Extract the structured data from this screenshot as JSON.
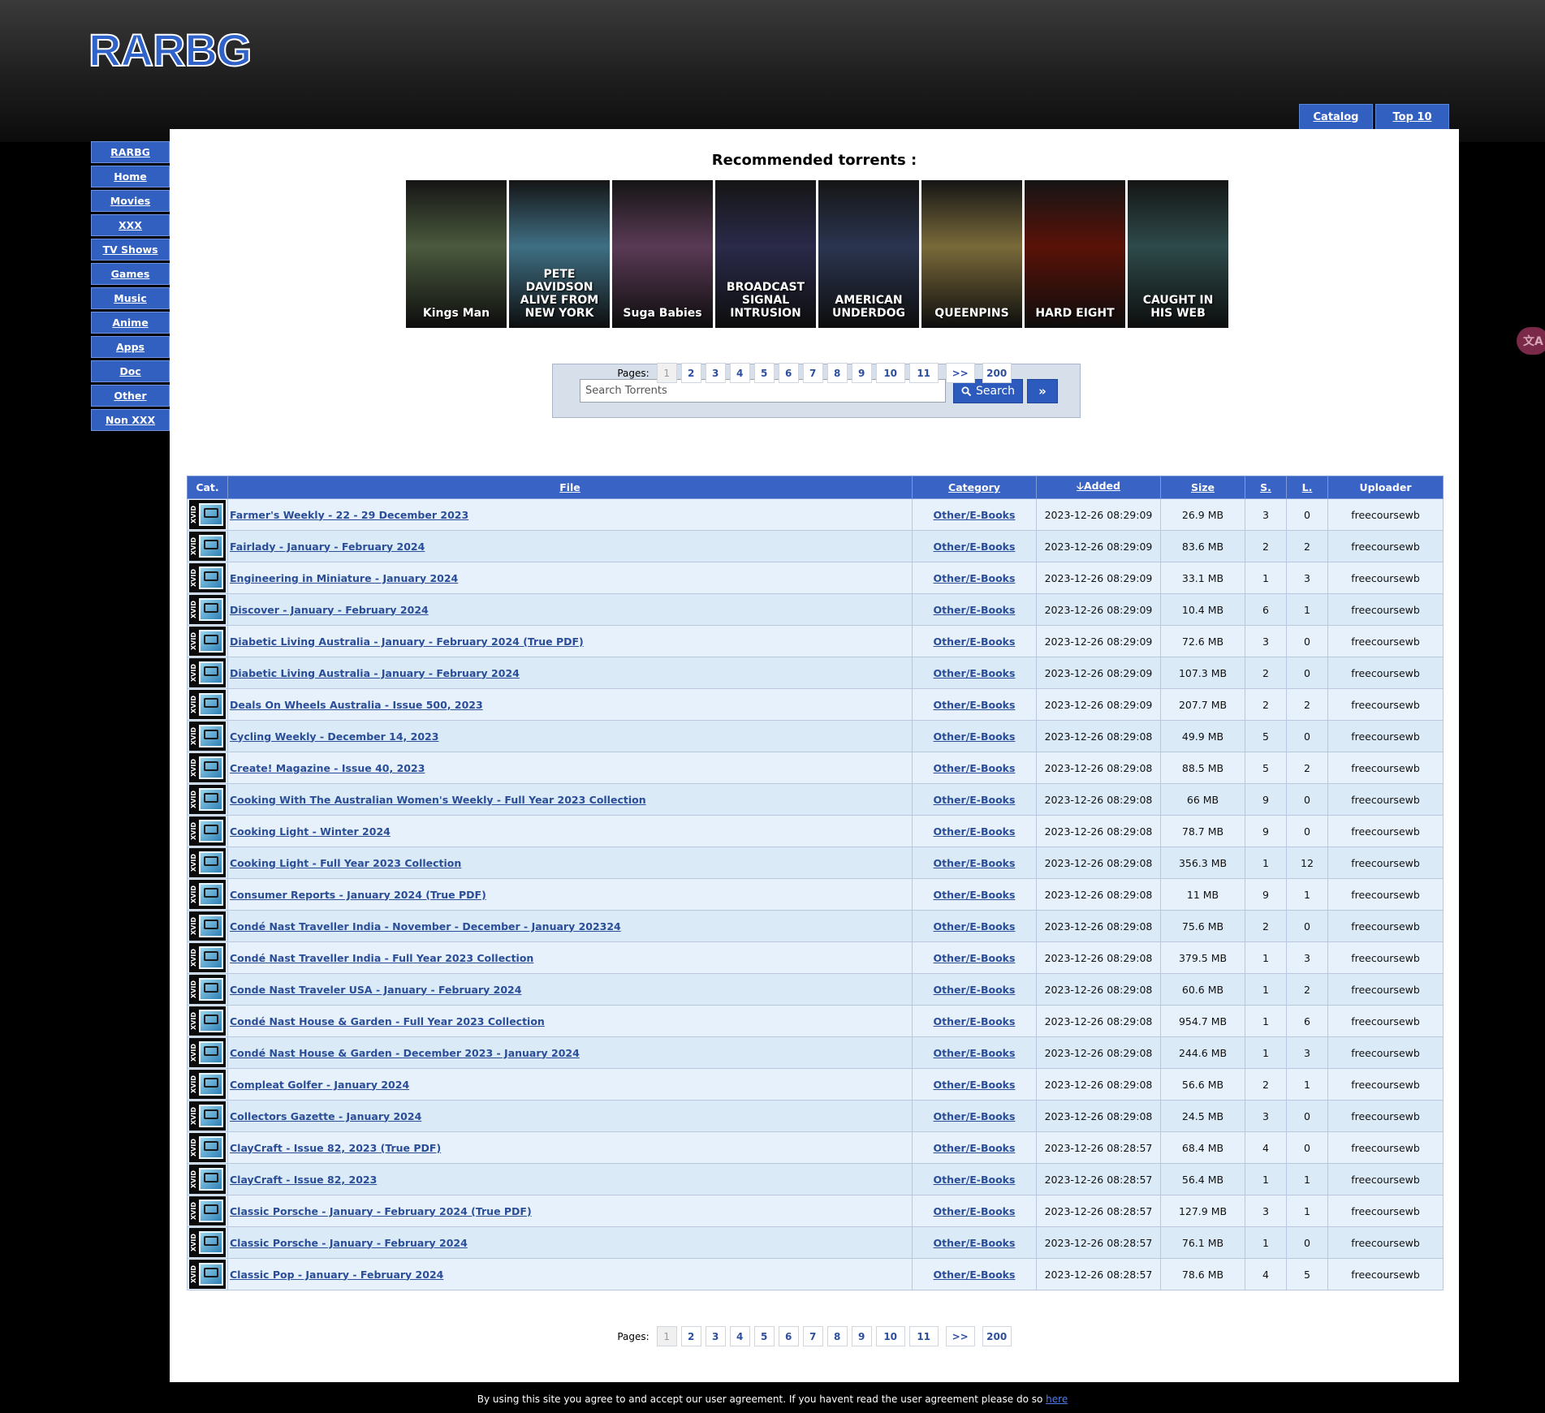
{
  "logo": "RARBG",
  "top_tabs": [
    "Catalog",
    "Top 10"
  ],
  "sidebar": [
    "RARBG",
    "Home",
    "Movies",
    "XXX",
    "TV Shows",
    "Games",
    "Music",
    "Anime",
    "Apps",
    "Doc",
    "Other",
    "Non XXX"
  ],
  "recommended": {
    "title": "Recommended torrents :",
    "posters": [
      {
        "text": "Kings Man",
        "bg": "#4b5a3e"
      },
      {
        "text": "PETE DAVIDSON ALIVE FROM NEW YORK",
        "bg": "#3f6f84"
      },
      {
        "text": "Suga Babies",
        "bg": "#5a3a55"
      },
      {
        "text": "BROADCAST SIGNAL INTRUSION",
        "bg": "#2a2a4a"
      },
      {
        "text": "AMERICAN UNDERDOG",
        "bg": "#2b3550"
      },
      {
        "text": "QUEENPINS",
        "bg": "#7a6a3a"
      },
      {
        "text": "HARD EIGHT",
        "bg": "#5a1208"
      },
      {
        "text": "CAUGHT IN HIS WEB",
        "bg": "#2e4a4a"
      }
    ]
  },
  "search": {
    "placeholder": "Search Torrents",
    "button": "Search",
    "advanced": "»"
  },
  "pager": {
    "label": "Pages:",
    "pages": [
      "1",
      "2",
      "3",
      "4",
      "5",
      "6",
      "7",
      "8",
      "9",
      "10",
      "11"
    ],
    "next": ">>",
    "last": "200"
  },
  "table": {
    "headers": [
      "Cat.",
      "File",
      "Category",
      "Added",
      "Size",
      "S.",
      "L.",
      "Uploader"
    ],
    "cat_icon_label": "XVID",
    "rows": [
      {
        "file": "Farmer's Weekly - 22 - 29 December 2023",
        "category": "Other/E-Books",
        "added": "2023-12-26 08:29:09",
        "size": "26.9 MB",
        "s": "3",
        "l": "0",
        "uploader": "freecoursewb"
      },
      {
        "file": "Fairlady - January - February 2024",
        "category": "Other/E-Books",
        "added": "2023-12-26 08:29:09",
        "size": "83.6 MB",
        "s": "2",
        "l": "2",
        "uploader": "freecoursewb"
      },
      {
        "file": "Engineering in Miniature - January 2024",
        "category": "Other/E-Books",
        "added": "2023-12-26 08:29:09",
        "size": "33.1 MB",
        "s": "1",
        "l": "3",
        "uploader": "freecoursewb"
      },
      {
        "file": "Discover - January - February 2024",
        "category": "Other/E-Books",
        "added": "2023-12-26 08:29:09",
        "size": "10.4 MB",
        "s": "6",
        "l": "1",
        "uploader": "freecoursewb"
      },
      {
        "file": "Diabetic Living Australia - January - February 2024 (True PDF)",
        "category": "Other/E-Books",
        "added": "2023-12-26 08:29:09",
        "size": "72.6 MB",
        "s": "3",
        "l": "0",
        "uploader": "freecoursewb"
      },
      {
        "file": "Diabetic Living Australia - January - February 2024",
        "category": "Other/E-Books",
        "added": "2023-12-26 08:29:09",
        "size": "107.3 MB",
        "s": "2",
        "l": "0",
        "uploader": "freecoursewb"
      },
      {
        "file": "Deals On Wheels Australia - Issue 500, 2023",
        "category": "Other/E-Books",
        "added": "2023-12-26 08:29:09",
        "size": "207.7 MB",
        "s": "2",
        "l": "2",
        "uploader": "freecoursewb"
      },
      {
        "file": "Cycling Weekly - December 14, 2023",
        "category": "Other/E-Books",
        "added": "2023-12-26 08:29:08",
        "size": "49.9 MB",
        "s": "5",
        "l": "0",
        "uploader": "freecoursewb"
      },
      {
        "file": "Create! Magazine - Issue 40, 2023",
        "category": "Other/E-Books",
        "added": "2023-12-26 08:29:08",
        "size": "88.5 MB",
        "s": "5",
        "l": "2",
        "uploader": "freecoursewb"
      },
      {
        "file": "Cooking With The Australian Women's Weekly - Full Year 2023 Collection",
        "category": "Other/E-Books",
        "added": "2023-12-26 08:29:08",
        "size": "66 MB",
        "s": "9",
        "l": "0",
        "uploader": "freecoursewb"
      },
      {
        "file": "Cooking Light - Winter 2024",
        "category": "Other/E-Books",
        "added": "2023-12-26 08:29:08",
        "size": "78.7 MB",
        "s": "9",
        "l": "0",
        "uploader": "freecoursewb"
      },
      {
        "file": "Cooking Light - Full Year 2023 Collection",
        "category": "Other/E-Books",
        "added": "2023-12-26 08:29:08",
        "size": "356.3 MB",
        "s": "1",
        "l": "12",
        "uploader": "freecoursewb"
      },
      {
        "file": "Consumer Reports - January 2024 (True PDF)",
        "category": "Other/E-Books",
        "added": "2023-12-26 08:29:08",
        "size": "11 MB",
        "s": "9",
        "l": "1",
        "uploader": "freecoursewb"
      },
      {
        "file": "Condé Nast Traveller India - November - December - January 202324",
        "category": "Other/E-Books",
        "added": "2023-12-26 08:29:08",
        "size": "75.6 MB",
        "s": "2",
        "l": "0",
        "uploader": "freecoursewb"
      },
      {
        "file": "Condé Nast Traveller India - Full Year 2023 Collection",
        "category": "Other/E-Books",
        "added": "2023-12-26 08:29:08",
        "size": "379.5 MB",
        "s": "1",
        "l": "3",
        "uploader": "freecoursewb"
      },
      {
        "file": "Conde Nast Traveler USA - January - February 2024",
        "category": "Other/E-Books",
        "added": "2023-12-26 08:29:08",
        "size": "60.6 MB",
        "s": "1",
        "l": "2",
        "uploader": "freecoursewb"
      },
      {
        "file": "Condé Nast House & Garden - Full Year 2023 Collection",
        "category": "Other/E-Books",
        "added": "2023-12-26 08:29:08",
        "size": "954.7 MB",
        "s": "1",
        "l": "6",
        "uploader": "freecoursewb"
      },
      {
        "file": "Condé Nast House & Garden - December 2023 - January 2024",
        "category": "Other/E-Books",
        "added": "2023-12-26 08:29:08",
        "size": "244.6 MB",
        "s": "1",
        "l": "3",
        "uploader": "freecoursewb"
      },
      {
        "file": "Compleat Golfer - January 2024",
        "category": "Other/E-Books",
        "added": "2023-12-26 08:29:08",
        "size": "56.6 MB",
        "s": "2",
        "l": "1",
        "uploader": "freecoursewb"
      },
      {
        "file": "Collectors Gazette - January 2024",
        "category": "Other/E-Books",
        "added": "2023-12-26 08:29:08",
        "size": "24.5 MB",
        "s": "3",
        "l": "0",
        "uploader": "freecoursewb"
      },
      {
        "file": "ClayCraft - Issue 82, 2023 (True PDF)",
        "category": "Other/E-Books",
        "added": "2023-12-26 08:28:57",
        "size": "68.4 MB",
        "s": "4",
        "l": "0",
        "uploader": "freecoursewb"
      },
      {
        "file": "ClayCraft - Issue 82, 2023",
        "category": "Other/E-Books",
        "added": "2023-12-26 08:28:57",
        "size": "56.4 MB",
        "s": "1",
        "l": "1",
        "uploader": "freecoursewb"
      },
      {
        "file": "Classic Porsche - January - February 2024 (True PDF)",
        "category": "Other/E-Books",
        "added": "2023-12-26 08:28:57",
        "size": "127.9 MB",
        "s": "3",
        "l": "1",
        "uploader": "freecoursewb"
      },
      {
        "file": "Classic Porsche - January - February 2024",
        "category": "Other/E-Books",
        "added": "2023-12-26 08:28:57",
        "size": "76.1 MB",
        "s": "1",
        "l": "0",
        "uploader": "freecoursewb"
      },
      {
        "file": "Classic Pop - January - February 2024",
        "category": "Other/E-Books",
        "added": "2023-12-26 08:28:57",
        "size": "78.6 MB",
        "s": "4",
        "l": "5",
        "uploader": "freecoursewb"
      }
    ]
  },
  "footer": {
    "text": "By using this site you agree to and accept our user agreement. If you havent read the user agreement please do so",
    "link": "here"
  },
  "translate_widget": "文A"
}
